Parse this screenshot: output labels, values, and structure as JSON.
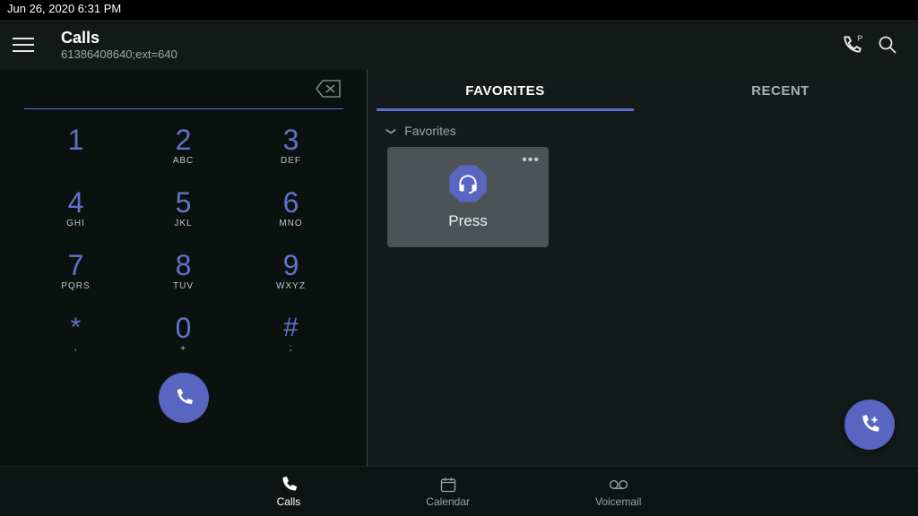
{
  "status_bar": {
    "datetime": "Jun 26, 2020  6:31 PM"
  },
  "header": {
    "title": "Calls",
    "subtitle": "61386408640;ext=640"
  },
  "dialer": {
    "keys": [
      {
        "digit": "1",
        "letters": ""
      },
      {
        "digit": "2",
        "letters": "ABC"
      },
      {
        "digit": "3",
        "letters": "DEF"
      },
      {
        "digit": "4",
        "letters": "GHI"
      },
      {
        "digit": "5",
        "letters": "JKL"
      },
      {
        "digit": "6",
        "letters": "MNO"
      },
      {
        "digit": "7",
        "letters": "PQRS"
      },
      {
        "digit": "8",
        "letters": "TUV"
      },
      {
        "digit": "9",
        "letters": "WXYZ"
      },
      {
        "digit": "*",
        "letters": ","
      },
      {
        "digit": "0",
        "letters": "+"
      },
      {
        "digit": "#",
        "letters": ";"
      }
    ]
  },
  "tabs": {
    "favorites": "FAVORITES",
    "recent": "RECENT",
    "active": "favorites"
  },
  "favorites": {
    "section_label": "Favorites",
    "items": [
      {
        "name": "Press",
        "icon": "headset-icon"
      }
    ]
  },
  "bottom_nav": {
    "calls": "Calls",
    "calendar": "Calendar",
    "voicemail": "Voicemail",
    "active": "calls"
  }
}
